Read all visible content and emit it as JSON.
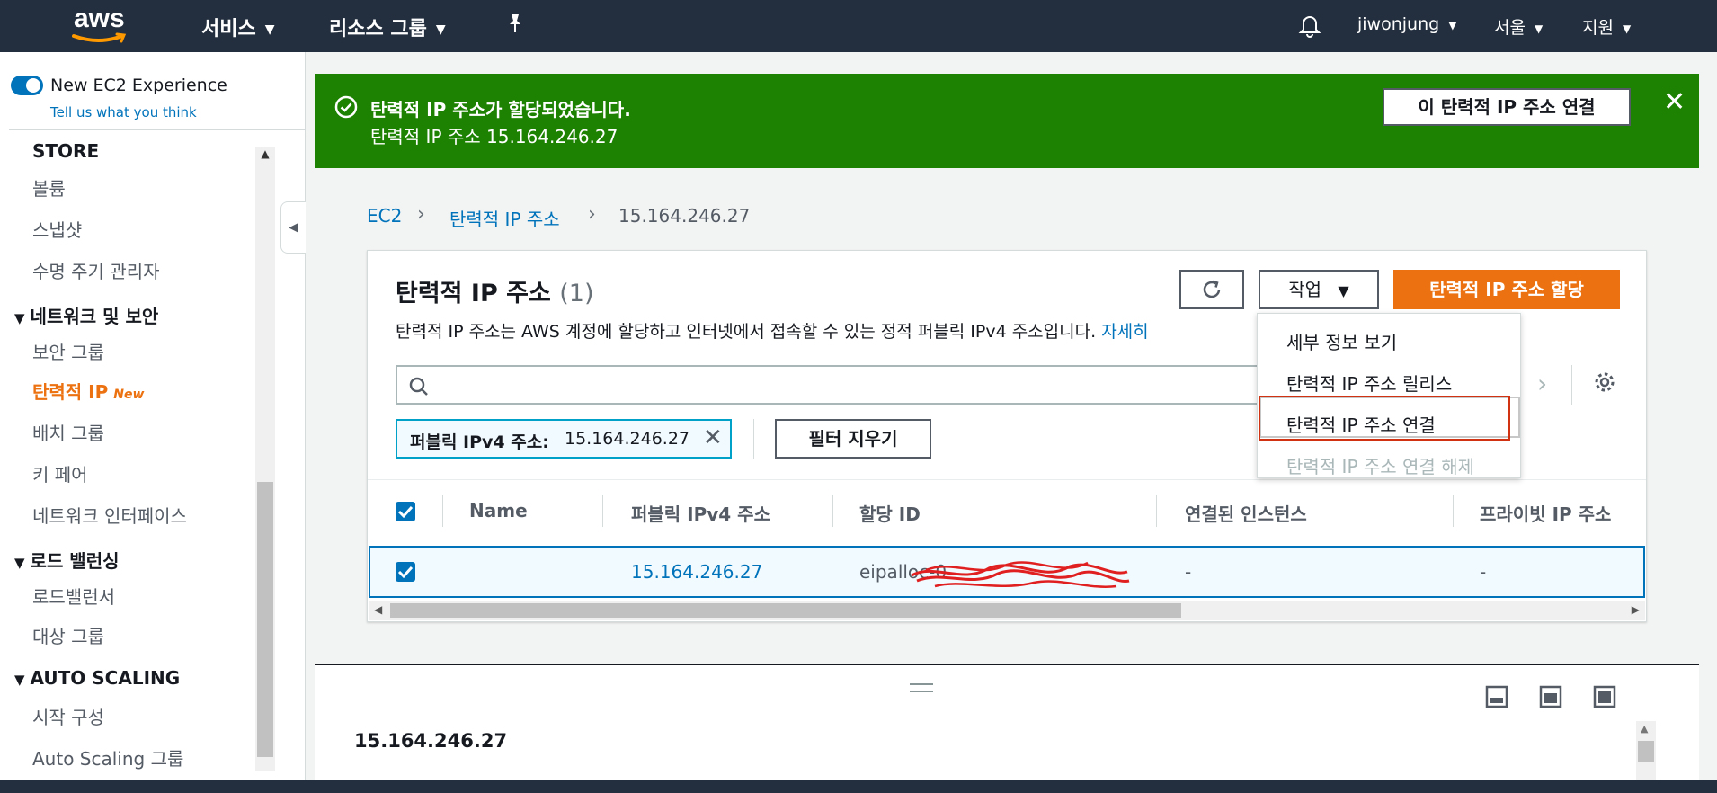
{
  "topnav": {
    "logo": "aws",
    "services": "서비스",
    "resource_groups": "리소스 그룹",
    "pin_icon": "pin-icon",
    "bell_icon": "bell-icon",
    "user": "jiwonjung",
    "region": "서울",
    "support": "지원"
  },
  "sidebar": {
    "new_experience": "New EC2 Experience",
    "tell_us": "Tell us what you think",
    "store_section": "STORE",
    "store_items": [
      "볼륨",
      "스냅샷",
      "수명 주기 관리자"
    ],
    "network_section": "네트워크 및 보안",
    "network_items": [
      "보안 그룹",
      "탄력적 IP",
      "배치 그룹",
      "키 페어",
      "네트워크 인터페이스"
    ],
    "new_badge": "New",
    "lb_section": "로드 밸런싱",
    "lb_items": [
      "로드밸런서",
      "대상 그룹"
    ],
    "as_section": "AUTO SCALING",
    "as_items": [
      "시작 구성",
      "Auto Scaling 그룹"
    ]
  },
  "flash": {
    "title": "탄력적 IP 주소가 할당되었습니다.",
    "subtitle": "탄력적 IP 주소 15.164.246.27",
    "button": "이 탄력적 IP 주소 연결",
    "close": "✕"
  },
  "breadcrumb": {
    "items": [
      "EC2",
      "탄력적 IP 주소",
      "15.164.246.27"
    ]
  },
  "card": {
    "title": "탄력적 IP 주소",
    "count": "(1)",
    "description": "탄력적 IP 주소는 AWS 계정에 할당하고 인터넷에서 접속할 수 있는 정적 퍼블릭 IPv4 주소입니다.",
    "learn_more": "자세히",
    "actions_label": "작업",
    "allocate_label": "탄력적 IP 주소 할당",
    "filter_token_label": "퍼블릭 IPv4 주소:",
    "filter_token_value": "15.164.246.27",
    "clear_filters": "필터 지우기"
  },
  "dropdown": {
    "items": [
      "세부 정보 보기",
      "탄력적 IP 주소 릴리스",
      "탄력적 IP 주소 연결",
      "탄력적 IP 주소 연결 해제"
    ]
  },
  "table": {
    "columns": [
      "Name",
      "퍼블릭 IPv4 주소",
      "할당 ID",
      "연결된 인스턴스",
      "프라이빗 IP 주소"
    ],
    "rows": [
      {
        "name": "",
        "public_ip": "15.164.246.27",
        "allocation_id": "eipalloc-0",
        "instance": "-",
        "private_ip": "-"
      }
    ]
  },
  "split_panel": {
    "title": "15.164.246.27"
  },
  "colors": {
    "nav_bg": "#232f3e",
    "success": "#1d8102",
    "primary": "#ec7211",
    "link": "#0073bb",
    "highlight_box": "#d13212"
  }
}
